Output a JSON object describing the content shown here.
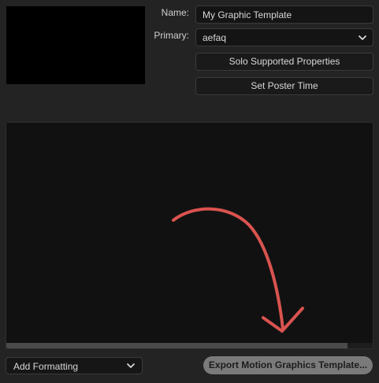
{
  "labels": {
    "name": "Name:",
    "primary": "Primary:"
  },
  "fields": {
    "name_value": "My Graphic Template",
    "primary_value": "aefaq"
  },
  "buttons": {
    "solo": "Solo Supported Properties",
    "set_poster": "Set Poster Time",
    "export": "Export Motion Graphics Template..."
  },
  "footer": {
    "add_formatting": "Add Formatting"
  },
  "colors": {
    "annotation_arrow": "#d9534f"
  },
  "icons": {
    "dropdown": "chevron-down-icon",
    "annotation": "curved-arrow-icon"
  }
}
